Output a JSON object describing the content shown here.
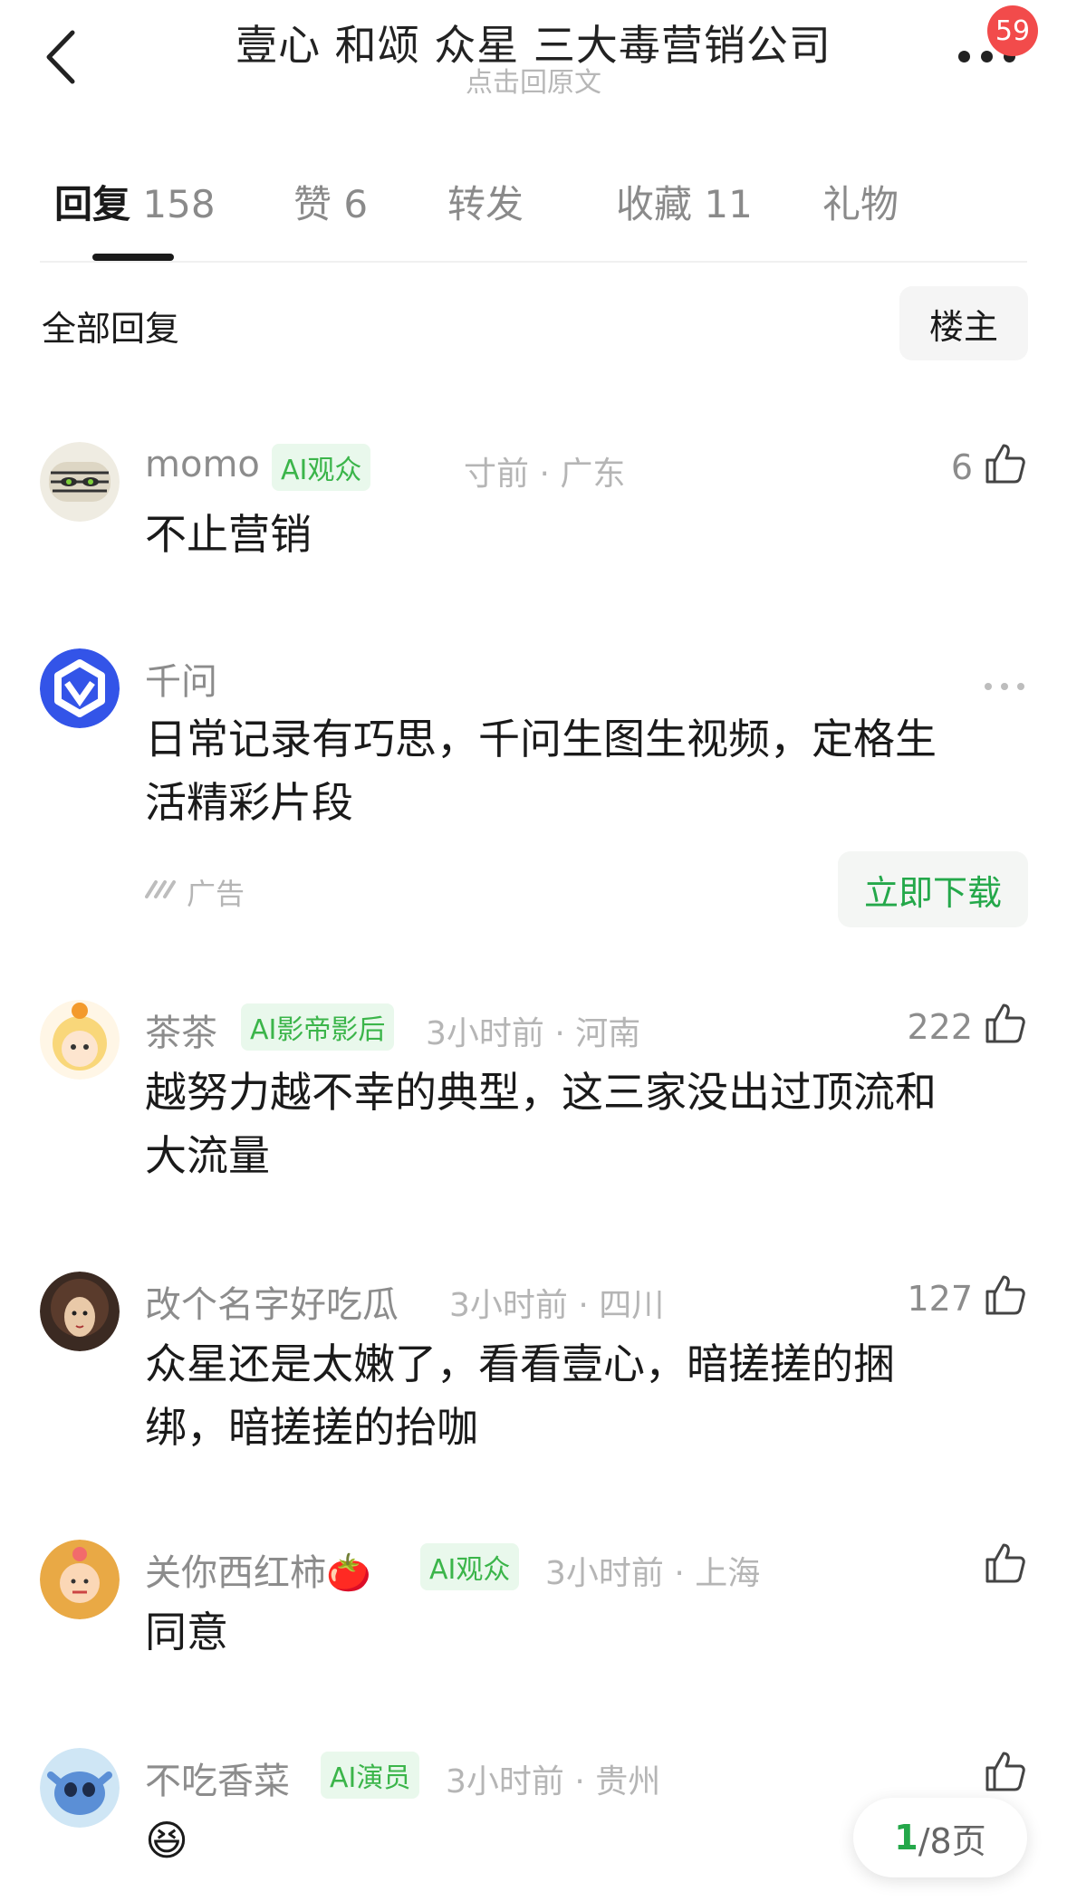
{
  "header": {
    "title": "壹心 和颂 众星 三大毒营销公司",
    "subtitle": "点击回原文",
    "notification_count": "59"
  },
  "tabs": [
    {
      "label": "回复",
      "count": "158"
    },
    {
      "label": "赞",
      "count": "6"
    },
    {
      "label": "转发",
      "count": ""
    },
    {
      "label": "收藏",
      "count": "11"
    },
    {
      "label": "礼物",
      "count": ""
    }
  ],
  "section": {
    "title": "全部回复",
    "owner_button": "楼主"
  },
  "comments": [
    {
      "user": "momo",
      "tag": "AI观众",
      "meta": "寸前 · 广东",
      "likes": "6",
      "text": "不止营销"
    },
    {
      "user": "茶茶",
      "tag": "AI影帝影后",
      "meta": "3小时前 · 河南",
      "likes": "222",
      "text_lines": [
        "越努力越不幸的典型，这三家没出过顶流和",
        "大流量"
      ]
    },
    {
      "user": "改个名字好吃瓜",
      "meta": "3小时前 · 四川",
      "likes": "127",
      "text_lines": [
        "众星还是太嫩了，看看壹心，暗搓搓的捆",
        "绑，暗搓搓的抬咖"
      ]
    },
    {
      "user": "关你西红柿🍅",
      "tag": "AI观众",
      "meta": "3小时前 · 上海",
      "likes": "",
      "text": "同意"
    },
    {
      "user": "不吃香菜",
      "tag": "AI演员",
      "meta": "3小时前 · 贵州",
      "likes": "",
      "text": "😆"
    }
  ],
  "ad": {
    "user": "千问",
    "text_lines": [
      "日常记录有巧思，千问生图生视频，定格生",
      "活精彩片段"
    ],
    "label": "广告",
    "button": "立即下载"
  },
  "pager": {
    "current": "1",
    "total": "/8页"
  },
  "colors": {
    "accent_green": "#24a84a",
    "badge_red": "#f24b4b"
  }
}
